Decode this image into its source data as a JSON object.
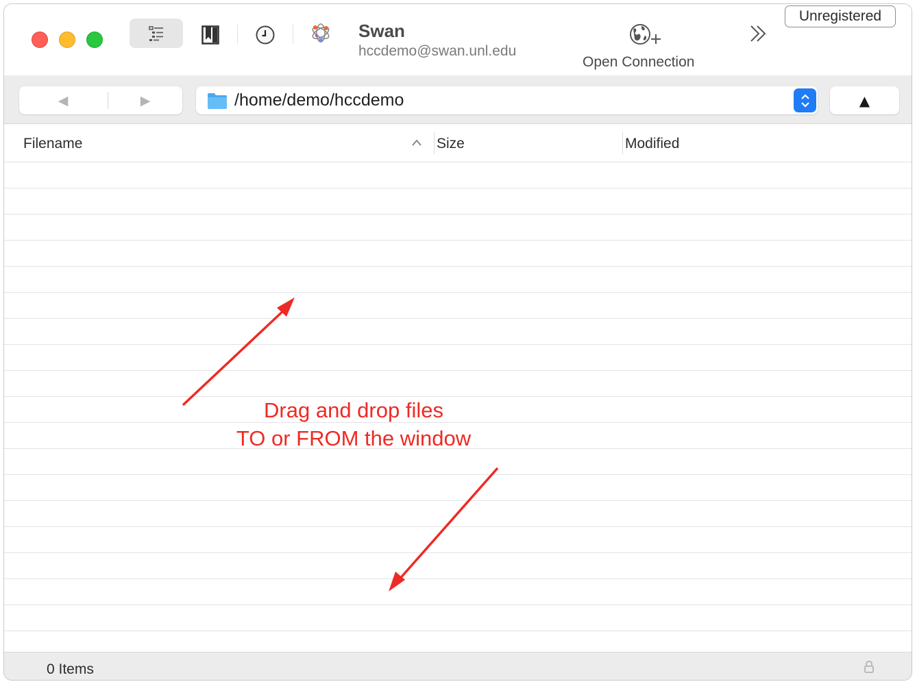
{
  "window": {
    "traffic_lights": [
      "close",
      "minimize",
      "zoom"
    ]
  },
  "toolbar": {
    "icons": [
      "outline-view-icon",
      "bookmarks-icon",
      "history-icon",
      "bonjour-icon"
    ],
    "host_name": "Swan",
    "host_address": "hccdemo@swan.unl.edu",
    "open_connection_label": "Open Connection",
    "overflow_icon": "chevrons-right-icon",
    "unregistered_label": "Unregistered"
  },
  "navigation": {
    "back_glyph": "◀",
    "forward_glyph": "▶",
    "path": "/home/demo/hccdemo",
    "up_glyph": "▲"
  },
  "table": {
    "columns": [
      "Filename",
      "Size",
      "Modified"
    ],
    "sort_column": "Filename",
    "sort_direction": "ascending",
    "rows": []
  },
  "annotation": {
    "line1": "Drag and drop files",
    "line2": "TO or FROM the window",
    "color": "#ee2a24"
  },
  "status": {
    "items_text": "0 Items",
    "lock_icon": "lock-icon"
  },
  "colors": {
    "accent": "#1f7cf4",
    "close": "#fe5f57",
    "minimize": "#febc2e",
    "zoom": "#28c840"
  }
}
